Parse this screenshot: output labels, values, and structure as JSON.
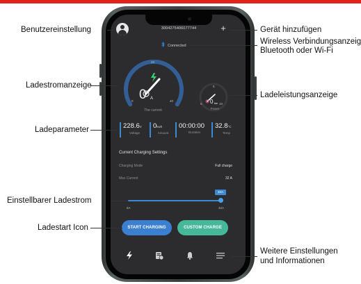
{
  "annotations": {
    "user_settings": "Benutzereinstellung",
    "add_device": "Gerät hinzufügen",
    "wireless_line1": "Wireless Verbindungsanzeige",
    "wireless_line2": "Bluetooth oder Wi-Fi",
    "current_display": "Ladestromanzeige",
    "power_display": "Ladeleistungsanzeige",
    "charge_params": "Ladeparameter",
    "adjustable_current": "Einstellbarer Ladestrom",
    "start_icon": "Ladestart Icon",
    "more_line1": "Weitere Einstellungen",
    "more_line2": "und Informationen"
  },
  "header": {
    "device_id": "3004275406077744",
    "add_symbol": "+",
    "avatar_icon": "user-avatar-icon"
  },
  "connection": {
    "status": "Connected",
    "icon": "bluetooth-icon"
  },
  "current_gauge": {
    "value": "0",
    "unit": "A",
    "min_label": "0",
    "mid_label": "20",
    "max_label": "40",
    "caption": "The current",
    "icon": "lightning-icon"
  },
  "power_gauge": {
    "value": "0",
    "unit": "kw",
    "min_label": "0",
    "mid_label": "5",
    "max_label": "10",
    "caption": "Power"
  },
  "params": [
    {
      "value": "228.6",
      "unit": "V",
      "label": "Voltage"
    },
    {
      "value": "0",
      "unit": "kwh",
      "label": "Amount"
    },
    {
      "value": "00:00:00",
      "unit": "",
      "label": "Duration"
    },
    {
      "value": "32.8",
      "unit": "°C",
      "label": "Temp"
    }
  ],
  "settings": {
    "title": "Current Charging Settings",
    "mode_label": "Charging Mode",
    "mode_value": "Full charge",
    "max_label": "Max Current",
    "max_value": "32 A"
  },
  "slider": {
    "badge": "32A",
    "min": "6A",
    "max": "32A",
    "value_fraction": 1.0
  },
  "buttons": {
    "start": "START CHARGING",
    "custom": "CUSTOM CHARGE"
  },
  "tabbar": [
    "lightning-icon",
    "history-icon",
    "bell-icon",
    "menu-icon"
  ],
  "colors": {
    "accent_blue": "#3b7fd0",
    "accent_green": "#46b89a",
    "brand_red": "#e2231a",
    "screen_bg": "#2c2c2e"
  }
}
